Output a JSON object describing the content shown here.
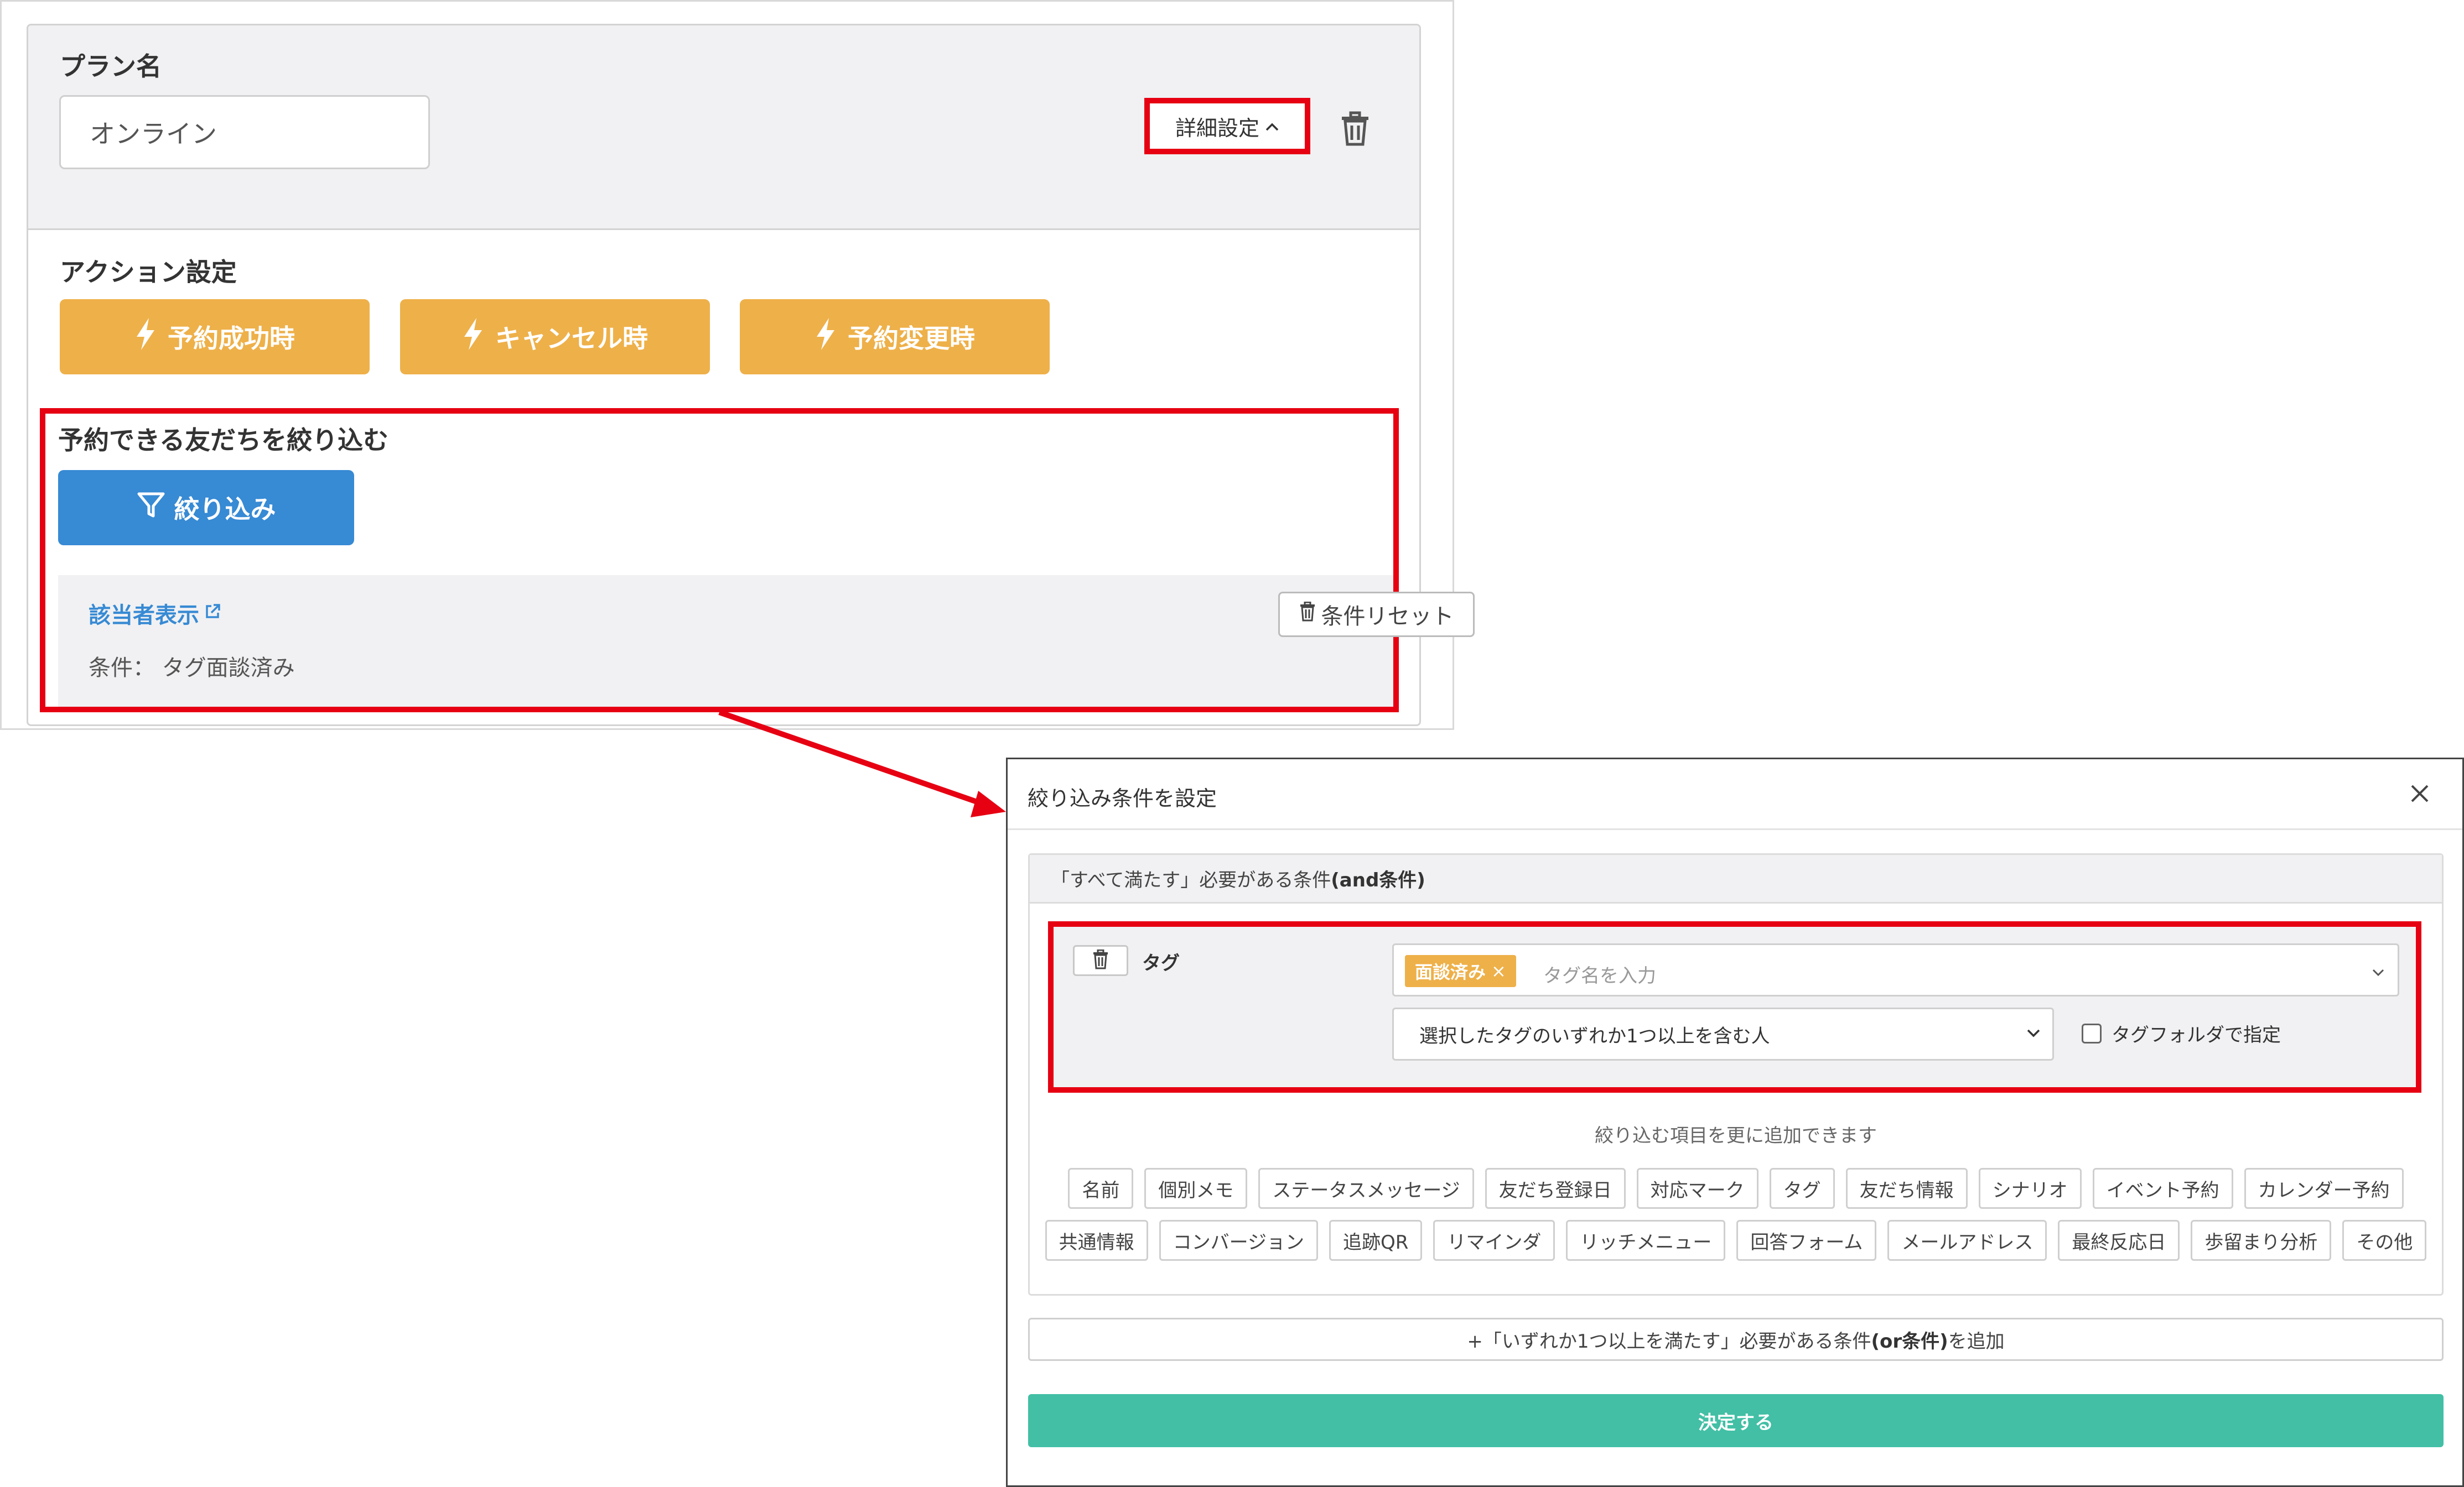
{
  "colors": {
    "highlight_red": "#e60012",
    "action_orange": "#eeb049",
    "filter_blue": "#378ad4",
    "submit_green": "#42bfa5",
    "panel_gray": "#f1f1f3"
  },
  "plan": {
    "name_label": "プラン名",
    "name_value": "オンライン",
    "detail_button": "詳細設定",
    "detail_icon": "chevron-up-icon",
    "delete_icon": "trash-icon"
  },
  "action": {
    "title": "アクション設定",
    "buttons": [
      {
        "label": "予約成功時",
        "icon": "lightning-icon"
      },
      {
        "label": "キャンセル時",
        "icon": "lightning-icon"
      },
      {
        "label": "予約変更時",
        "icon": "lightning-icon"
      }
    ]
  },
  "filter": {
    "title": "予約できる友だちを絞り込む",
    "button_label": "絞り込み",
    "button_icon": "funnel-icon",
    "show_matching": "該当者表示",
    "external_icon": "external-link-icon",
    "reset_label": "条件リセット",
    "condition_text": "条件： タグ面談済み"
  },
  "modal": {
    "title": "絞り込み条件を設定",
    "close_icon": "close-icon",
    "and_head_prefix": "「すべて満たす」必要がある条件 ",
    "and_head_bold": "(and条件)",
    "condition": {
      "label": "タグ",
      "chip": "面談済み",
      "chip_remove": "×",
      "placeholder": "タグ名を入力",
      "match_select": "選択したタグのいずれか1つ以上を含む人",
      "folder_checkbox": "タグフォルダで指定"
    },
    "add_more_text": "絞り込む項目を更に追加できます",
    "chips_row1": [
      "名前",
      "個別メモ",
      "ステータスメッセージ",
      "友だち登録日",
      "対応マーク",
      "タグ",
      "友だち情報",
      "シナリオ",
      "イベント予約",
      "カレンダー予約"
    ],
    "chips_row2": [
      "共通情報",
      "コンバージョン",
      "追跡QR",
      "リマインダ",
      "リッチメニュー",
      "回答フォーム",
      "メールアドレス",
      "最終反応日",
      "歩留まり分析",
      "その他"
    ],
    "or_add_prefix": "+「いずれか1つ以上を満たす」必要がある条件",
    "or_add_bold": "(or条件)",
    "or_add_suffix": "を追加",
    "submit_label": "決定する"
  }
}
